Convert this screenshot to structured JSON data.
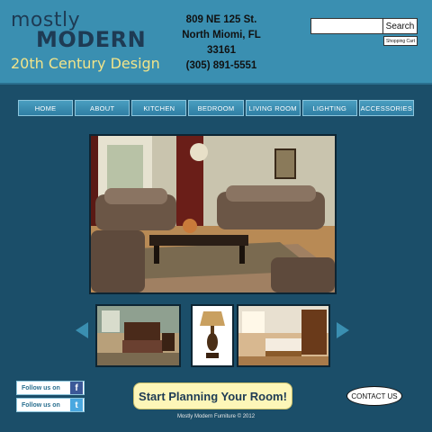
{
  "brand": {
    "line1": "mostly",
    "line2": "MODERN",
    "line3": "20th Century Design"
  },
  "address": {
    "street": "809 NE 125 St.",
    "city": "North Miomi, FL 33161",
    "phone": "(305) 891-5551"
  },
  "search": {
    "button_label": "Search",
    "input_value": ""
  },
  "cart": {
    "label": "Shopping Cart"
  },
  "nav": {
    "items": [
      "HOME",
      "ABOUT",
      "KITCHEN",
      "BEDROOM",
      "LIVING ROOM",
      "LIGHTING",
      "ACCESSORIES"
    ]
  },
  "social": {
    "facebook_label": "Follow us on",
    "twitter_label": "Follow us on",
    "facebook_icon": "f",
    "twitter_icon": "t"
  },
  "cta": {
    "planning_label": "Start Planning Your Room!",
    "contact_label": "CONTACT US"
  },
  "footer": {
    "text": "Mostly Modern Furniture  © 2012"
  },
  "colors": {
    "background": "#1b4e69",
    "header": "#3a8fb1",
    "brand_yellow": "#f1e48a",
    "cta_yellow": "#fdf6b8"
  }
}
